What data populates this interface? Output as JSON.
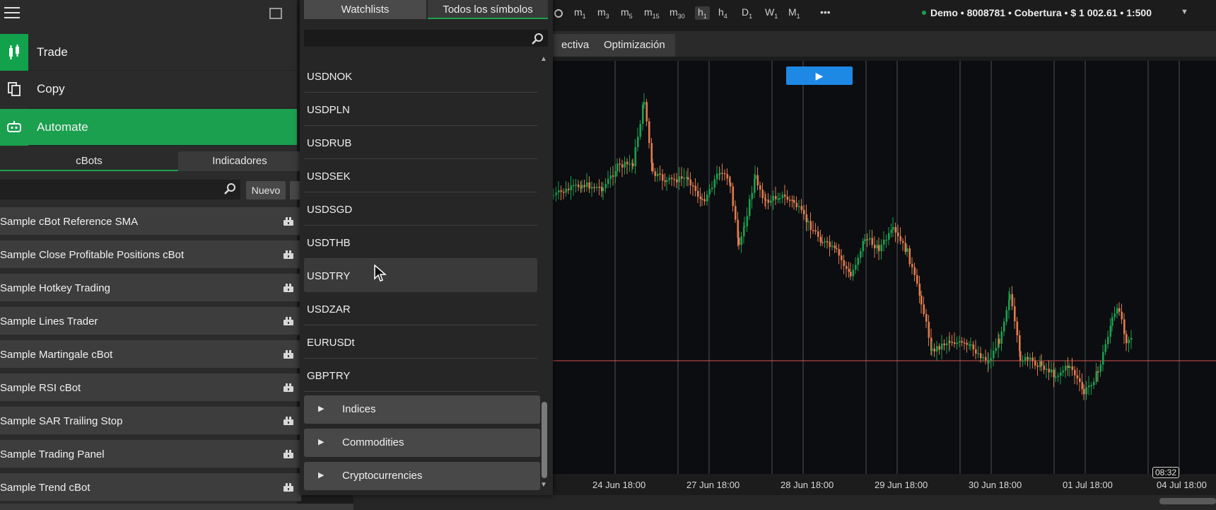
{
  "left_panel": {
    "nav": [
      {
        "label": "Trade",
        "icon": "candlestick-icon"
      },
      {
        "label": "Copy",
        "icon": "copy-icon"
      },
      {
        "label": "Automate",
        "icon": "robot-icon"
      }
    ],
    "subtabs": [
      "cBots",
      "Indicadores"
    ],
    "new_button": "Nuevo",
    "bots": [
      "Sample cBot Reference SMA",
      "Sample Close Profitable Positions cBot",
      "Sample Hotkey Trading",
      "Sample Lines Trader",
      "Sample Martingale cBot",
      "Sample RSI cBot",
      "Sample SAR Trailing Stop",
      "Sample Trading Panel",
      "Sample Trend cBot"
    ]
  },
  "dropdown": {
    "tabs": [
      "Watchlists",
      "Todos los símbolos"
    ],
    "search_value": "",
    "symbols": [
      "USDNOK",
      "USDPLN",
      "USDRUB",
      "USDSEK",
      "USDSGD",
      "USDTHB",
      "USDTRY",
      "USDZAR",
      "EURUSDt",
      "GBPTRY"
    ],
    "hovered_symbol": "USDTRY",
    "categories": [
      "Indices",
      "Commodities",
      "Cryptocurrencies"
    ]
  },
  "toolbar": {
    "timeframes": [
      {
        "main": "m",
        "sub": "1"
      },
      {
        "main": "m",
        "sub": "3"
      },
      {
        "main": "m",
        "sub": "5"
      },
      {
        "main": "m",
        "sub": "15"
      },
      {
        "main": "m",
        "sub": "30"
      },
      {
        "main": "h",
        "sub": "1"
      },
      {
        "main": "h",
        "sub": "4"
      },
      {
        "main": "D",
        "sub": "1"
      },
      {
        "main": "W",
        "sub": "1"
      },
      {
        "main": "M",
        "sub": "1"
      }
    ],
    "active_timeframe": "h1",
    "more": "•••",
    "account": "Demo • 8008781 • Cobertura • $ 1 002.61 • 1:500"
  },
  "chart_tabs": [
    "ectiva",
    "Optimización"
  ],
  "chart": {
    "x_labels": [
      "24 Jun 18:00",
      "27 Jun 18:00",
      "28 Jun 18:00",
      "29 Jun 18:00",
      "30 Jun 18:00",
      "01 Jul 18:00",
      "04 Jul 18:00"
    ],
    "time_badge": "08:32",
    "colors": {
      "up": "#1aa04f",
      "down": "#e07b4f",
      "price_line": "#d9534f"
    }
  }
}
